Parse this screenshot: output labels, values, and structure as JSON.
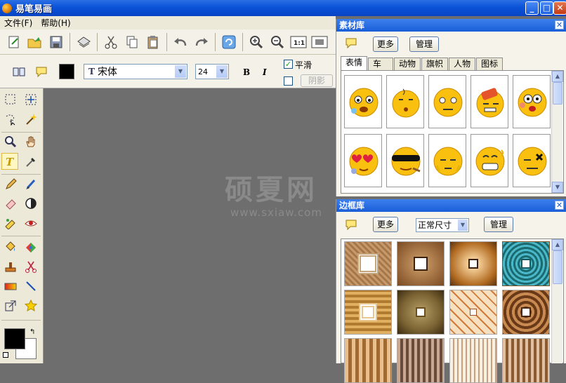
{
  "window": {
    "title": "易笔易画"
  },
  "menu": {
    "file": "文件(F)",
    "help": "帮助(H)"
  },
  "text_toolbar": {
    "font_name": "宋体",
    "font_size": "24",
    "bold": "B",
    "italic": "I",
    "smooth_label": "平滑",
    "smooth_checked": true,
    "shadow_label": "阴影",
    "shadow_checked": false,
    "fg_color": "#000000"
  },
  "material_panel": {
    "title": "素材库",
    "more_btn": "更多",
    "manage_btn": "管理",
    "tabs": [
      "表情",
      "车",
      "动物",
      "旗帜",
      "人物",
      "图标"
    ],
    "active_tab": 0
  },
  "frame_panel": {
    "title": "边框库",
    "more_btn": "更多",
    "size_select": "正常尺寸",
    "manage_btn": "管理"
  },
  "watermark": {
    "line1": "硕夏网",
    "line2": "www.sxiaw.com"
  },
  "colors": {
    "titlebar": "#0a52d8",
    "panel_head": "#1a5ed8",
    "canvas": "#6e6e6e"
  }
}
